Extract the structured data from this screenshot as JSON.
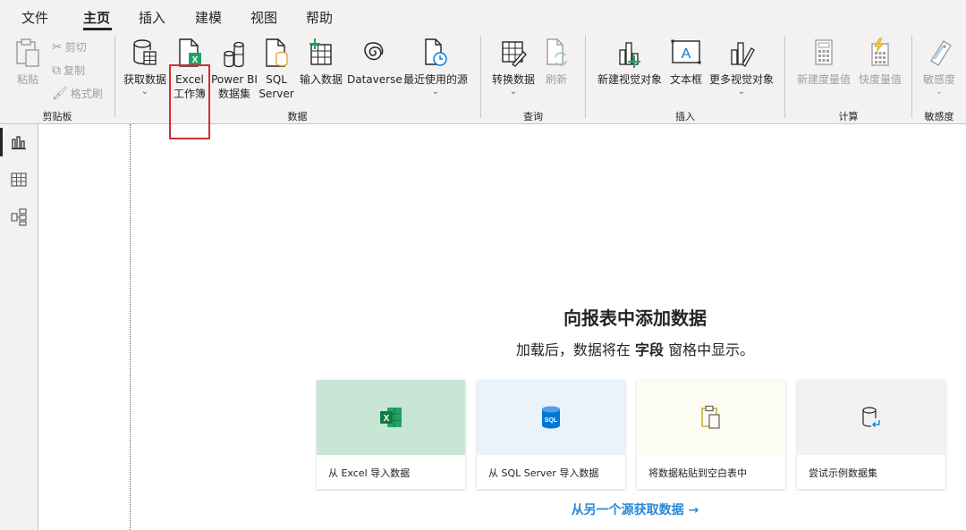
{
  "menu": {
    "tabs": [
      "文件",
      "主页",
      "插入",
      "建模",
      "视图",
      "帮助"
    ]
  },
  "clipboard": {
    "paste": "粘贴",
    "cut": "剪切",
    "copy": "复制",
    "format_painter": "格式刷",
    "label": "剪贴板"
  },
  "data_group": {
    "get_data": "获取数据",
    "excel_line1": "Excel",
    "excel_line2": "工作簿",
    "powerbi_line1": "Power BI",
    "powerbi_line2": "数据集",
    "sql_line1": "SQL",
    "sql_line2": "Server",
    "enter_data": "输入数据",
    "dataverse": "Dataverse",
    "recent": "最近使用的源",
    "label": "数据"
  },
  "query_group": {
    "transform": "转换数据",
    "refresh": "刷新",
    "label": "查询"
  },
  "insert_group": {
    "new_visual": "新建视觉对象",
    "text_box": "文本框",
    "more_visuals": "更多视觉对象",
    "label": "插入"
  },
  "calc_group": {
    "new_measure": "新建度量值",
    "quick_measure": "快度量值",
    "label": "计算"
  },
  "sensitivity_group": {
    "sensitivity": "敏感度",
    "label": "敏感度"
  },
  "canvas": {
    "title": "向报表中添加数据",
    "subtitle_pre": "加载后，数据将在",
    "subtitle_bold": "字段",
    "subtitle_post": "窗格中显示。",
    "cards": [
      {
        "label": "从 Excel 导入数据"
      },
      {
        "label": "从 SQL Server 导入数据"
      },
      {
        "label": "将数据粘贴到空白表中"
      },
      {
        "label": "尝试示例数据集"
      }
    ],
    "more_link": "从另一个源获取数据 →"
  },
  "colors": {
    "excel_green": "#21a366",
    "sql_blue": "#0078d4",
    "link_blue": "#2b88d8",
    "highlight_red": "#d32f2f",
    "card_excel_bg": "#c8e6d5",
    "card_sql_bg": "#eaf3fb",
    "card_paste_bg": "#fcfcf3",
    "card_sample_bg": "#f3f2f1"
  }
}
